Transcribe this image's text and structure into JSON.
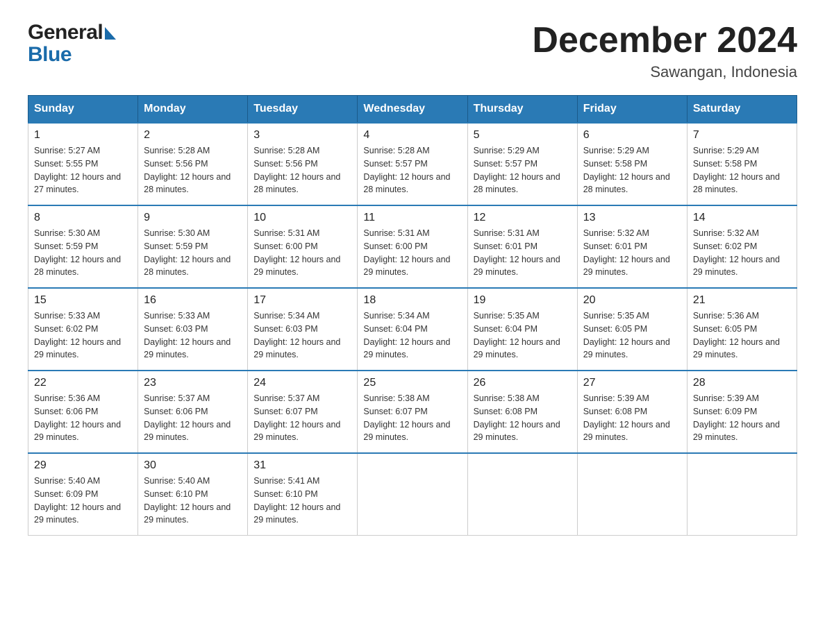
{
  "header": {
    "month_title": "December 2024",
    "location": "Sawangan, Indonesia",
    "logo_general": "General",
    "logo_blue": "Blue"
  },
  "days_of_week": [
    "Sunday",
    "Monday",
    "Tuesday",
    "Wednesday",
    "Thursday",
    "Friday",
    "Saturday"
  ],
  "weeks": [
    [
      {
        "day": "1",
        "sunrise": "5:27 AM",
        "sunset": "5:55 PM",
        "daylight": "12 hours and 27 minutes."
      },
      {
        "day": "2",
        "sunrise": "5:28 AM",
        "sunset": "5:56 PM",
        "daylight": "12 hours and 28 minutes."
      },
      {
        "day": "3",
        "sunrise": "5:28 AM",
        "sunset": "5:56 PM",
        "daylight": "12 hours and 28 minutes."
      },
      {
        "day": "4",
        "sunrise": "5:28 AM",
        "sunset": "5:57 PM",
        "daylight": "12 hours and 28 minutes."
      },
      {
        "day": "5",
        "sunrise": "5:29 AM",
        "sunset": "5:57 PM",
        "daylight": "12 hours and 28 minutes."
      },
      {
        "day": "6",
        "sunrise": "5:29 AM",
        "sunset": "5:58 PM",
        "daylight": "12 hours and 28 minutes."
      },
      {
        "day": "7",
        "sunrise": "5:29 AM",
        "sunset": "5:58 PM",
        "daylight": "12 hours and 28 minutes."
      }
    ],
    [
      {
        "day": "8",
        "sunrise": "5:30 AM",
        "sunset": "5:59 PM",
        "daylight": "12 hours and 28 minutes."
      },
      {
        "day": "9",
        "sunrise": "5:30 AM",
        "sunset": "5:59 PM",
        "daylight": "12 hours and 28 minutes."
      },
      {
        "day": "10",
        "sunrise": "5:31 AM",
        "sunset": "6:00 PM",
        "daylight": "12 hours and 29 minutes."
      },
      {
        "day": "11",
        "sunrise": "5:31 AM",
        "sunset": "6:00 PM",
        "daylight": "12 hours and 29 minutes."
      },
      {
        "day": "12",
        "sunrise": "5:31 AM",
        "sunset": "6:01 PM",
        "daylight": "12 hours and 29 minutes."
      },
      {
        "day": "13",
        "sunrise": "5:32 AM",
        "sunset": "6:01 PM",
        "daylight": "12 hours and 29 minutes."
      },
      {
        "day": "14",
        "sunrise": "5:32 AM",
        "sunset": "6:02 PM",
        "daylight": "12 hours and 29 minutes."
      }
    ],
    [
      {
        "day": "15",
        "sunrise": "5:33 AM",
        "sunset": "6:02 PM",
        "daylight": "12 hours and 29 minutes."
      },
      {
        "day": "16",
        "sunrise": "5:33 AM",
        "sunset": "6:03 PM",
        "daylight": "12 hours and 29 minutes."
      },
      {
        "day": "17",
        "sunrise": "5:34 AM",
        "sunset": "6:03 PM",
        "daylight": "12 hours and 29 minutes."
      },
      {
        "day": "18",
        "sunrise": "5:34 AM",
        "sunset": "6:04 PM",
        "daylight": "12 hours and 29 minutes."
      },
      {
        "day": "19",
        "sunrise": "5:35 AM",
        "sunset": "6:04 PM",
        "daylight": "12 hours and 29 minutes."
      },
      {
        "day": "20",
        "sunrise": "5:35 AM",
        "sunset": "6:05 PM",
        "daylight": "12 hours and 29 minutes."
      },
      {
        "day": "21",
        "sunrise": "5:36 AM",
        "sunset": "6:05 PM",
        "daylight": "12 hours and 29 minutes."
      }
    ],
    [
      {
        "day": "22",
        "sunrise": "5:36 AM",
        "sunset": "6:06 PM",
        "daylight": "12 hours and 29 minutes."
      },
      {
        "day": "23",
        "sunrise": "5:37 AM",
        "sunset": "6:06 PM",
        "daylight": "12 hours and 29 minutes."
      },
      {
        "day": "24",
        "sunrise": "5:37 AM",
        "sunset": "6:07 PM",
        "daylight": "12 hours and 29 minutes."
      },
      {
        "day": "25",
        "sunrise": "5:38 AM",
        "sunset": "6:07 PM",
        "daylight": "12 hours and 29 minutes."
      },
      {
        "day": "26",
        "sunrise": "5:38 AM",
        "sunset": "6:08 PM",
        "daylight": "12 hours and 29 minutes."
      },
      {
        "day": "27",
        "sunrise": "5:39 AM",
        "sunset": "6:08 PM",
        "daylight": "12 hours and 29 minutes."
      },
      {
        "day": "28",
        "sunrise": "5:39 AM",
        "sunset": "6:09 PM",
        "daylight": "12 hours and 29 minutes."
      }
    ],
    [
      {
        "day": "29",
        "sunrise": "5:40 AM",
        "sunset": "6:09 PM",
        "daylight": "12 hours and 29 minutes."
      },
      {
        "day": "30",
        "sunrise": "5:40 AM",
        "sunset": "6:10 PM",
        "daylight": "12 hours and 29 minutes."
      },
      {
        "day": "31",
        "sunrise": "5:41 AM",
        "sunset": "6:10 PM",
        "daylight": "12 hours and 29 minutes."
      },
      null,
      null,
      null,
      null
    ]
  ],
  "labels": {
    "sunrise_prefix": "Sunrise: ",
    "sunset_prefix": "Sunset: ",
    "daylight_prefix": "Daylight: "
  }
}
